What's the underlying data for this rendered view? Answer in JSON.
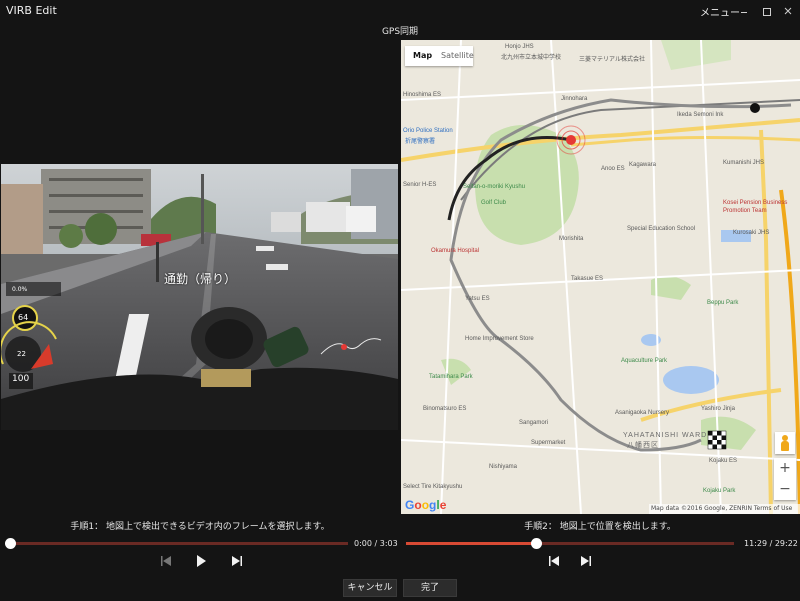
{
  "window": {
    "app_title": "VIRB Edit",
    "menu_label": "メニュー",
    "dialog_title": "GPS同期"
  },
  "video": {
    "caption": "通勤（帰り）",
    "overlay": {
      "speed": "64",
      "value_small": "22",
      "value_large": "100",
      "grade": "0.0%"
    },
    "step_label": "手順1： 地図上で検出できるビデオ内のフレームを選択します。",
    "time_display": "0:00 / 3:03",
    "progress": 0.0
  },
  "map": {
    "type_map": "Map",
    "type_satellite": "Satellite",
    "zoom_in": "+",
    "zoom_out": "−",
    "logo": "Google",
    "attribution": "Map data ©2016 Google, ZENRIN   Terms of Use",
    "labels": [
      {
        "text": "Honjo JHS",
        "cls": ""
      },
      {
        "text": "北九州市立本城中学校",
        "cls": ""
      },
      {
        "text": "三菱マテリアル株式会社",
        "cls": ""
      },
      {
        "text": "Jinnohara",
        "cls": ""
      },
      {
        "text": "Ikeda Semoni Ink",
        "cls": ""
      },
      {
        "text": "Hinoshima ES",
        "cls": ""
      },
      {
        "text": "Orio Police Station",
        "cls": "blue"
      },
      {
        "text": "折尾警察署",
        "cls": "blue"
      },
      {
        "text": "Anoo ES",
        "cls": ""
      },
      {
        "text": "Kagawara",
        "cls": ""
      },
      {
        "text": "Kumanishi JHS",
        "cls": ""
      },
      {
        "text": "Kosei Pension Business",
        "cls": "red"
      },
      {
        "text": "Promotion Team",
        "cls": "red"
      },
      {
        "text": "Seitan-o-moriki Kyushu",
        "cls": "green"
      },
      {
        "text": "Golf Club",
        "cls": "green"
      },
      {
        "text": "Senior H-ES",
        "cls": ""
      },
      {
        "text": "Kurosaki JHS",
        "cls": ""
      },
      {
        "text": "Okamura Hospital",
        "cls": "red"
      },
      {
        "text": "Special Education School",
        "cls": ""
      },
      {
        "text": "Morishita",
        "cls": ""
      },
      {
        "text": "Yatsu ES",
        "cls": ""
      },
      {
        "text": "Takasue ES",
        "cls": ""
      },
      {
        "text": "Beppu Park",
        "cls": "green"
      },
      {
        "text": "Home Improvement Store",
        "cls": ""
      },
      {
        "text": "Aquaculture Park",
        "cls": "green"
      },
      {
        "text": "Tatamihara Park",
        "cls": "green"
      },
      {
        "text": "Binomatsuro ES",
        "cls": ""
      },
      {
        "text": "Asanigaoka Nursery",
        "cls": ""
      },
      {
        "text": "Sangamori",
        "cls": ""
      },
      {
        "text": "YAHATANISHI WARD",
        "cls": "big"
      },
      {
        "text": "八幡西区",
        "cls": "big"
      },
      {
        "text": "Supermarket",
        "cls": ""
      },
      {
        "text": "Nishiyama",
        "cls": ""
      },
      {
        "text": "Select Tire Kitakyushu",
        "cls": ""
      },
      {
        "text": "Kojaku ES",
        "cls": ""
      },
      {
        "text": "Kojaku Park",
        "cls": "green"
      },
      {
        "text": "Yashiro Jinja",
        "cls": ""
      }
    ],
    "step_label": "手順2： 地図上で位置を検出します。",
    "time_display": "11:29 / 29:22",
    "progress": 0.395
  },
  "footer": {
    "cancel_label": "キャンセル",
    "done_label": "完了"
  },
  "colors": {
    "track_played": "#d84a34",
    "track_remaining": "#6a2a24",
    "route": "#222222",
    "marker": "#e53935"
  },
  "icons": {
    "prev_frame": "skip-back-icon",
    "play": "play-icon",
    "next_frame": "skip-forward-icon"
  }
}
